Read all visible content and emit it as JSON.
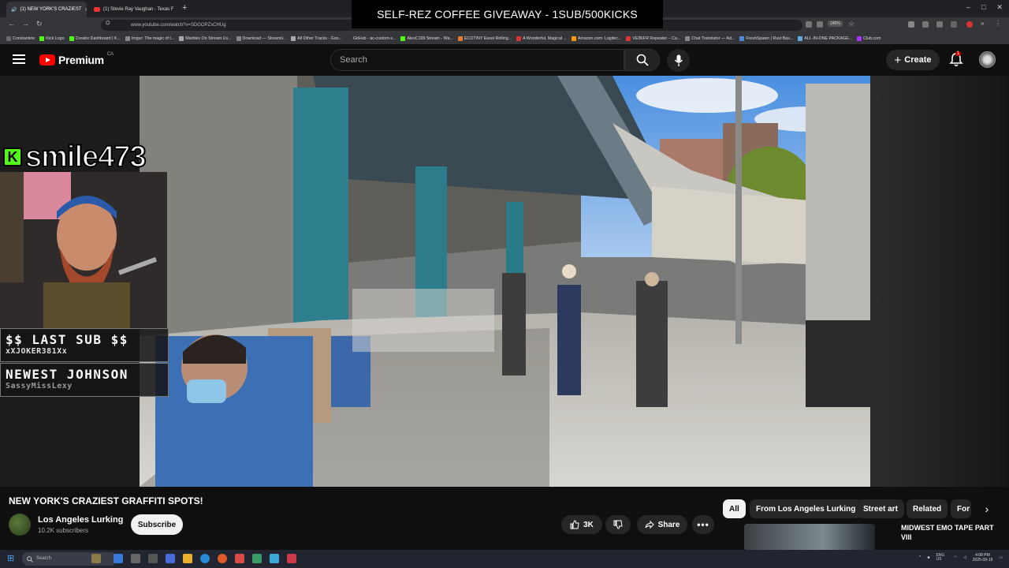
{
  "browser": {
    "tabs": [
      {
        "label": "(1) NEW YORK'S CRAZIEST"
      },
      {
        "label": "(1) Stevie Ray Vaughan - Texas F"
      }
    ],
    "url": "www.youtube.com/watch?v=SDGOPZxCHUg",
    "zoom": "140%",
    "bookmarks": [
      "Constantine",
      "Kick Logo",
      "Creator Dashboard | K...",
      "Imgur: The magic of t...",
      "Marbles On Stream Us...",
      "Download — Streamli...",
      "All Other Tracks - Goo...",
      "GitHub - ac-custom-s...",
      "AlexC199 Stream - Wa...",
      "ECOTINY Easel Rolling...",
      "A Wonderful, Magical ...",
      "Amazon.com: Logitec...",
      "VE3KFR Repeater – Ca...",
      "Chat Translator — Ad...",
      "FreshSpawn | Rust Bas...",
      "ALL-IN-ONE PACKAGE...",
      "Club.com"
    ]
  },
  "overlay": {
    "banner": "SELF-REZ COFFEE GIVEAWAY - 1SUB/500KICKS",
    "streamer": "smile473",
    "kick_letter": "K",
    "last_sub_title": "$$ LAST SUB $$",
    "last_sub_name": "xXJOKER381Xx",
    "newest_title": "NEWEST JOHNSON",
    "newest_name": "SassyMissLexy"
  },
  "youtube": {
    "logo_text": "Premium",
    "country": "CA",
    "search_placeholder": "Search",
    "create_label": "Create",
    "notifications_count": "1",
    "video_title": "NEW YORK'S CRAZIEST GRAFFITI SPOTS!",
    "channel_name": "Los Angeles Lurking",
    "channel_subs": "10.2K subscribers",
    "subscribe_label": "Subscribe",
    "like_count": "3K",
    "share_label": "Share",
    "chips": [
      "All",
      "From Los Angeles Lurking",
      "Street art",
      "Related",
      "For"
    ],
    "recommended_title": "MIDWEST EMO TAPE PART VIII"
  },
  "taskbar": {
    "search_placeholder": "Search",
    "lang": "ENG US",
    "time": "4:08 PM",
    "date": "2025-09-19"
  },
  "colors": {
    "youtube_red": "#ff0000",
    "kick_green": "#53fc18",
    "background": "#0f0f0f"
  }
}
